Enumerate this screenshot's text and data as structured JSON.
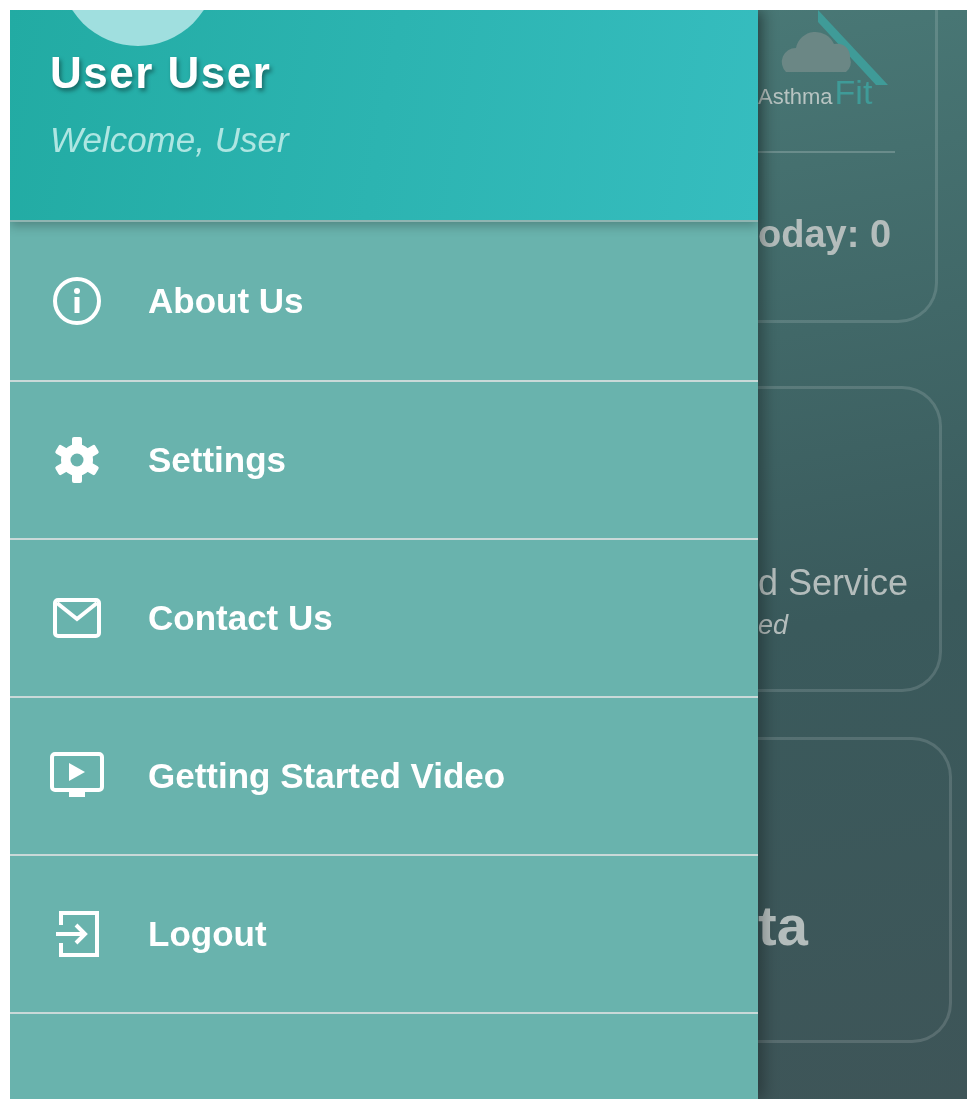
{
  "drawer": {
    "user_name": "User User",
    "welcome": "Welcome, User",
    "items": [
      {
        "label": "About Us",
        "kind": "info"
      },
      {
        "label": "Settings",
        "kind": "gear"
      },
      {
        "label": "Contact Us",
        "kind": "mail"
      },
      {
        "label": "Getting Started Video",
        "kind": "video"
      },
      {
        "label": "Logout",
        "kind": "logout"
      }
    ]
  },
  "background": {
    "logo": {
      "text": "Asthma",
      "accent": "Fit"
    },
    "cards": [
      {
        "lines": [
          {
            "kind": "value",
            "text": "oday: 0"
          }
        ]
      },
      {
        "lines": [
          {
            "kind": "title",
            "text": "d Service"
          },
          {
            "kind": "subtitle",
            "text": "ed"
          }
        ]
      },
      {
        "lines": [
          {
            "kind": "big",
            "text": "ta"
          }
        ]
      }
    ]
  }
}
